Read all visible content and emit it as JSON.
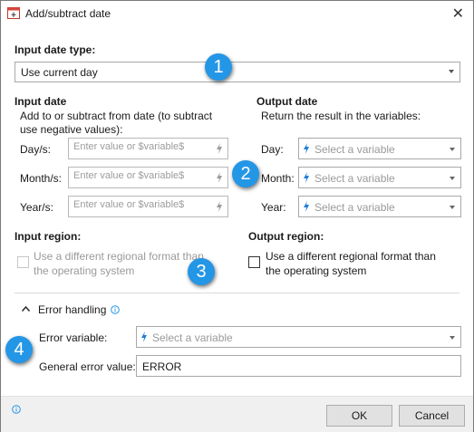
{
  "window": {
    "title": "Add/subtract date",
    "close_glyph": "✕"
  },
  "input_type": {
    "label": "Input date type:",
    "value": "Use current day"
  },
  "input_date": {
    "heading": "Input date",
    "description": "Add to or subtract from date (to subtract use negative values):",
    "description_line1": "Add to or subtract from date (to subtract",
    "description_line2": "use negative values):",
    "rows": [
      {
        "label": "Day/s:",
        "placeholder": "Enter value or $variable$"
      },
      {
        "label": "Month/s:",
        "placeholder": "Enter value or $variable$"
      },
      {
        "label": "Year/s:",
        "placeholder": "Enter value or $variable$"
      }
    ]
  },
  "output_date": {
    "heading": "Output date",
    "description": "Return the result in the variables:",
    "rows": [
      {
        "label": "Day:",
        "placeholder": "Select a variable"
      },
      {
        "label": "Month:",
        "placeholder": "Select a variable"
      },
      {
        "label": "Year:",
        "placeholder": "Select a variable"
      }
    ]
  },
  "input_region": {
    "heading": "Input region:",
    "checkbox_line1": "Use a different regional format than",
    "checkbox_line2": "the operating system",
    "checked": false
  },
  "output_region": {
    "heading": "Output region:",
    "checkbox_line1": "Use a different regional format than",
    "checkbox_line2": "the operating system",
    "checked": false
  },
  "error_handling": {
    "heading": "Error handling",
    "variable_label": "Error variable:",
    "variable_placeholder": "Select a variable",
    "value_label": "General error value:",
    "value": "ERROR"
  },
  "badges": [
    "1",
    "2",
    "3",
    "4"
  ],
  "footer": {
    "ok": "OK",
    "cancel": "Cancel"
  },
  "colors": {
    "accent": "#2496e6",
    "bolt": "#1f7fd8"
  }
}
